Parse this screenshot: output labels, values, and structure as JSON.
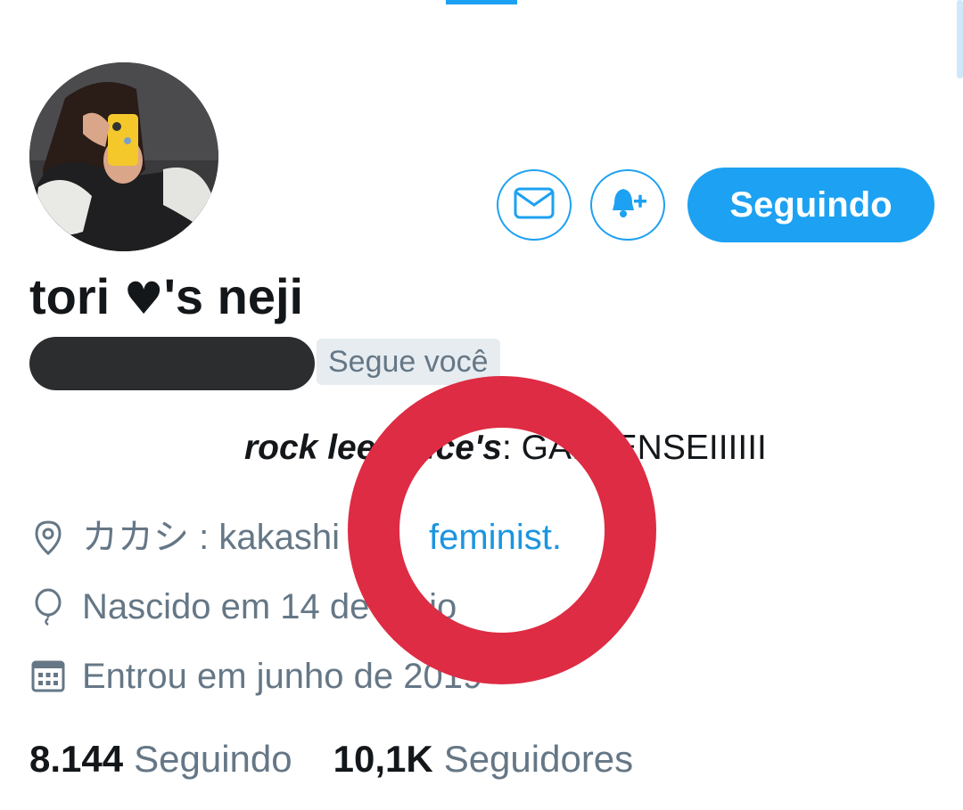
{
  "profile": {
    "display_name": "tori ",
    "display_heart": "♥",
    "display_suffix": "'s neji",
    "follows_you": "Segue você",
    "bio_bold": "rock lee voice's",
    "bio_rest": ": GAI SENSEIIIIII",
    "location": "カカシ : kakashi",
    "location_link": "feminist.",
    "birth": "Nascido em 14 de maio",
    "joined": "Entrou em junho de 2019"
  },
  "actions": {
    "follow_label": "Seguindo"
  },
  "stats": {
    "following_count": "8.144",
    "following_label": "Seguindo",
    "followers_count": "10,1K",
    "followers_label": "Seguidores"
  },
  "icons": {
    "message": "envelope-icon",
    "notify": "bell-plus-icon",
    "location": "location-pin-icon",
    "birth": "balloon-icon",
    "joined": "calendar-icon"
  },
  "colors": {
    "accent": "#1da1f2",
    "link": "#1b95e0",
    "secondary_text": "#657786",
    "annotation_red": "#dd2c44"
  }
}
